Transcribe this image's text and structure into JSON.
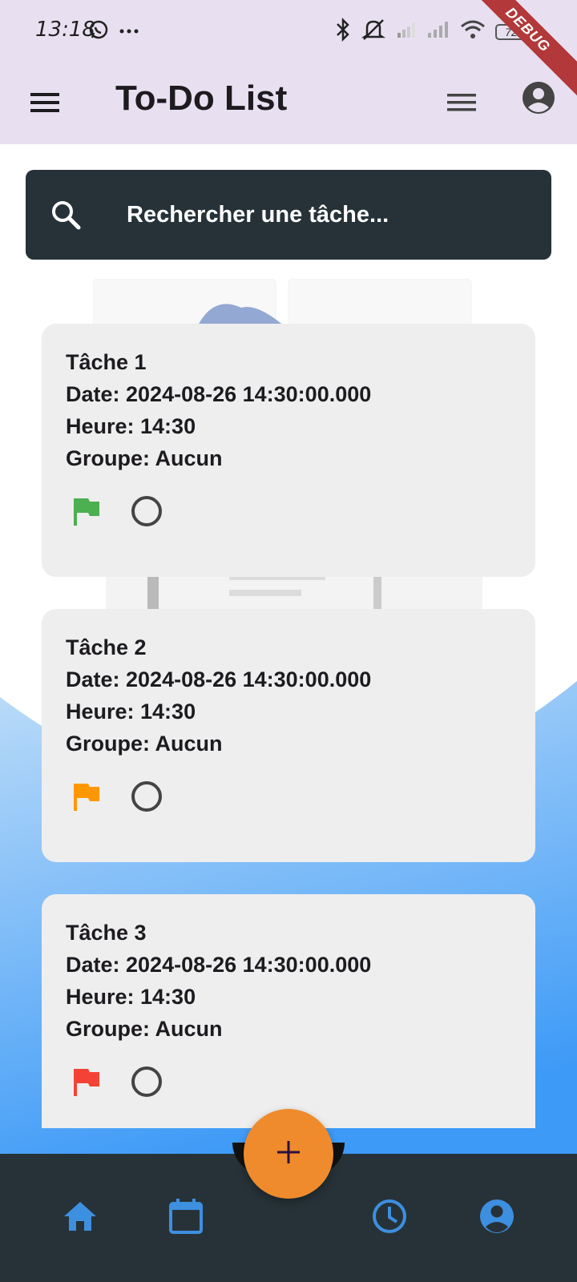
{
  "status_bar": {
    "time": "13:18",
    "battery": "72",
    "debug_label": "DEBUG"
  },
  "app_bar": {
    "title": "To-Do List",
    "menu_icon": "hamburger-menu-icon",
    "list_icon": "list-icon",
    "profile_icon": "account-circle-icon"
  },
  "search": {
    "placeholder": "Rechercher une tâche..."
  },
  "tasks": [
    {
      "title": "Tâche 1",
      "date": "Date: 2024-08-26 14:30:00.000",
      "time": "Heure: 14:30",
      "group": "Groupe: Aucun",
      "flag_color": "#4caf50"
    },
    {
      "title": "Tâche 2",
      "date": "Date: 2024-08-26 14:30:00.000",
      "time": "Heure: 14:30",
      "group": "Groupe: Aucun",
      "flag_color": "#ff9800"
    },
    {
      "title": "Tâche 3",
      "date": "Date: 2024-08-26 14:30:00.000",
      "time": "Heure: 14:30",
      "group": "Groupe: Aucun",
      "flag_color": "#f44336"
    }
  ],
  "fab": {
    "icon": "plus-icon",
    "color": "#ef8b2c"
  },
  "bottom_nav": {
    "items": [
      {
        "icon": "home-icon"
      },
      {
        "icon": "calendar-icon"
      },
      {
        "icon": "clock-icon"
      },
      {
        "icon": "account-circle-icon"
      }
    ],
    "accent_color": "#3d8fe0"
  }
}
